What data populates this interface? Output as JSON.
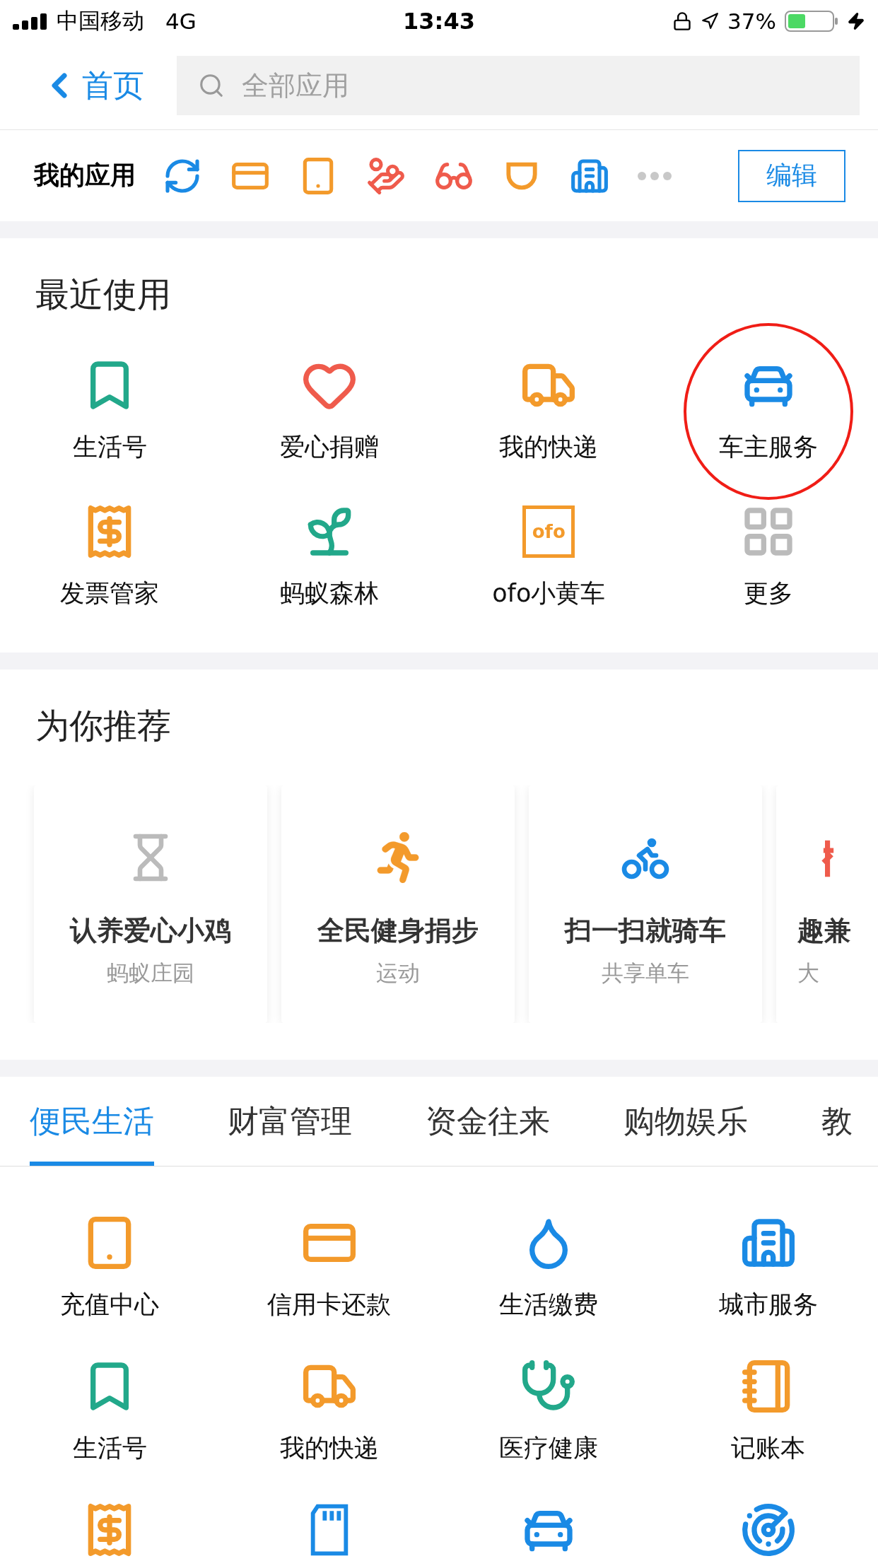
{
  "status_bar": {
    "carrier": "中国移动",
    "network": "4G",
    "time": "13:43",
    "battery": "37%"
  },
  "nav": {
    "back": "首页",
    "search": {
      "placeholder": "全部应用"
    }
  },
  "my_apps": {
    "title": "我的应用",
    "icons": [
      {
        "kind": "exchange"
      },
      {
        "kind": "card"
      },
      {
        "kind": "tablet"
      },
      {
        "kind": "coins"
      },
      {
        "kind": "glasses"
      },
      {
        "kind": "cup"
      },
      {
        "kind": "building"
      },
      {
        "kind": "more"
      }
    ],
    "edit": "编辑"
  },
  "recent": {
    "title": "最近使用",
    "items": [
      {
        "label": "生活号",
        "kind": "bookmark",
        "highlighted": false
      },
      {
        "label": "爱心捐赠",
        "kind": "heart",
        "highlighted": false
      },
      {
        "label": "我的快递",
        "kind": "truck",
        "highlighted": false
      },
      {
        "label": "车主服务",
        "kind": "car",
        "highlighted": true
      },
      {
        "label": "发票管家",
        "kind": "receipt",
        "highlighted": false
      },
      {
        "label": "蚂蚁森林",
        "kind": "sprout",
        "highlighted": false
      },
      {
        "label": "ofo小黄车",
        "kind": "logo",
        "logo": "ofo",
        "highlighted": false
      },
      {
        "label": "更多",
        "kind": "grid",
        "highlighted": false
      }
    ]
  },
  "recommended": {
    "title": "为你推荐",
    "cards": [
      {
        "title": "认养爱心小鸡",
        "subtitle": "蚂蚁庄园",
        "kind": "hourglass",
        "cut_off": false
      },
      {
        "title": "全民健身捐步",
        "subtitle": "运动",
        "kind": "runner",
        "cut_off": false
      },
      {
        "title": "扫一扫就骑车",
        "subtitle": "共享单车",
        "kind": "bike",
        "cut_off": false
      },
      {
        "title": "趣兼",
        "subtitle": "大",
        "kind": "partial",
        "cut_off": true
      }
    ]
  },
  "tabs": [
    {
      "label": "便民生活",
      "selected": true
    },
    {
      "label": "财富管理",
      "selected": false
    },
    {
      "label": "资金往来",
      "selected": false
    },
    {
      "label": "购物娱乐",
      "selected": false
    },
    {
      "label": "教",
      "selected": false
    }
  ],
  "grid": [
    {
      "label": "充值中心",
      "kind": "tablet"
    },
    {
      "label": "信用卡还款",
      "kind": "card"
    },
    {
      "label": "生活缴费",
      "kind": "drop"
    },
    {
      "label": "城市服务",
      "kind": "building"
    },
    {
      "label": "生活号",
      "kind": "bookmark"
    },
    {
      "label": "我的快递",
      "kind": "truck"
    },
    {
      "label": "医疗健康",
      "kind": "stethoscope"
    },
    {
      "label": "记账本",
      "kind": "notebook"
    },
    {
      "kind": "receipt"
    },
    {
      "kind": "sdcard"
    },
    {
      "kind": "car"
    },
    {
      "kind": "radar"
    }
  ]
}
